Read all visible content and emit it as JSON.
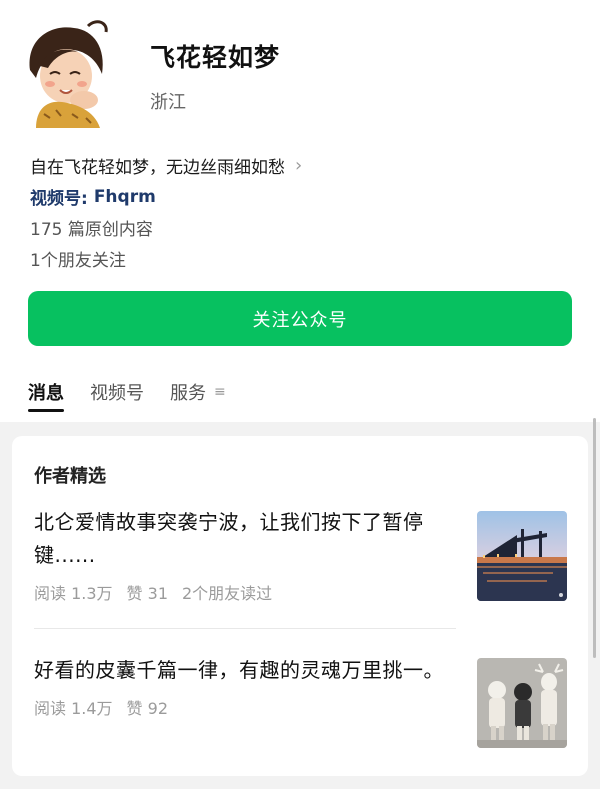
{
  "account": {
    "name": "飞花轻如梦",
    "region": "浙江",
    "bio": "自在飞花轻如梦，无边丝雨细如愁",
    "channel_label": "视频号:",
    "channel_value": "Fhqrm",
    "original_count": "175 篇原创内容",
    "friends_following": "1个朋友关注"
  },
  "follow_button": {
    "label": "关注公众号"
  },
  "tabs": [
    {
      "label": "消息",
      "active": true
    },
    {
      "label": "视频号",
      "active": false
    },
    {
      "label": "服务",
      "active": false
    }
  ],
  "featured": {
    "section_title": "作者精选",
    "articles": [
      {
        "title": "北仑爱情故事突袭宁波，让我们按下了暂停键......",
        "reads": "阅读 1.3万",
        "likes": "赞 31",
        "friends_read": "2个朋友读过",
        "thumbnail": "port-night-image"
      },
      {
        "title": "好看的皮囊千篇一律，有趣的灵魂万里挑一。",
        "reads": "阅读 1.4万",
        "likes": "赞 92",
        "thumbnail": "sculptures-image"
      }
    ]
  },
  "icons": {
    "chevron": "chevron-right-icon",
    "menu": "menu-icon"
  },
  "colors": {
    "accent_green": "#07c160",
    "channel_blue": "#1f3a6b"
  }
}
